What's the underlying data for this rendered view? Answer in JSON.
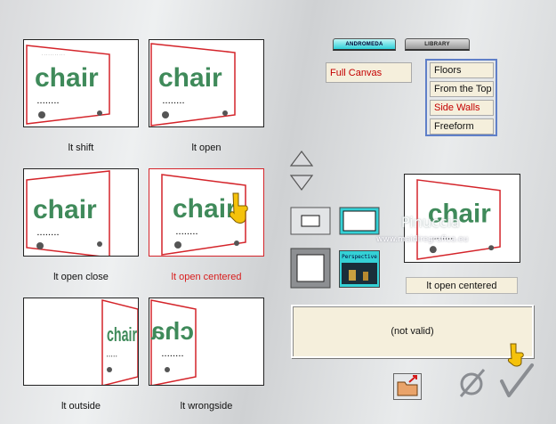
{
  "tabs": [
    {
      "label": "ANDROMEDA",
      "active": true
    },
    {
      "label": "LIBRARY",
      "active": false
    }
  ],
  "canvas_mode": "Full Canvas",
  "placement_options": [
    {
      "label": "Floors",
      "active": false
    },
    {
      "label": "From the Top",
      "active": false
    },
    {
      "label": "Side Walls",
      "active": true
    },
    {
      "label": "Freeform",
      "active": false
    }
  ],
  "thumbnail_word": "chair",
  "presets": [
    {
      "label": "lt shift",
      "selected": false
    },
    {
      "label": "lt open",
      "selected": false
    },
    {
      "label": "lt open close",
      "selected": false
    },
    {
      "label": "lt open centered",
      "selected": true
    },
    {
      "label": "lt outside",
      "selected": false
    },
    {
      "label": "lt wrongside",
      "selected": false
    }
  ],
  "perspective_button_label": "Perspective",
  "preview_label": "lt open centered",
  "status_text": "(not valid)",
  "watermark": {
    "name": "Pinuccia",
    "url": "www.maidiregrafica.eu"
  },
  "icons": [
    "arrow-up-icon",
    "arrow-down-icon",
    "rectangle-icon",
    "wide-rectangle-icon",
    "frame-icon",
    "perspective-icon",
    "folder-icon",
    "cancel-icon",
    "checkmark-icon",
    "pointing-hand-icon"
  ],
  "colors": {
    "accent_red": "#d81c1c",
    "list_border": "#5f7fc8",
    "field_bg": "#f5efdc",
    "cyan_tab": "#2ecfd8",
    "chair_green": "#3f8a5a"
  }
}
